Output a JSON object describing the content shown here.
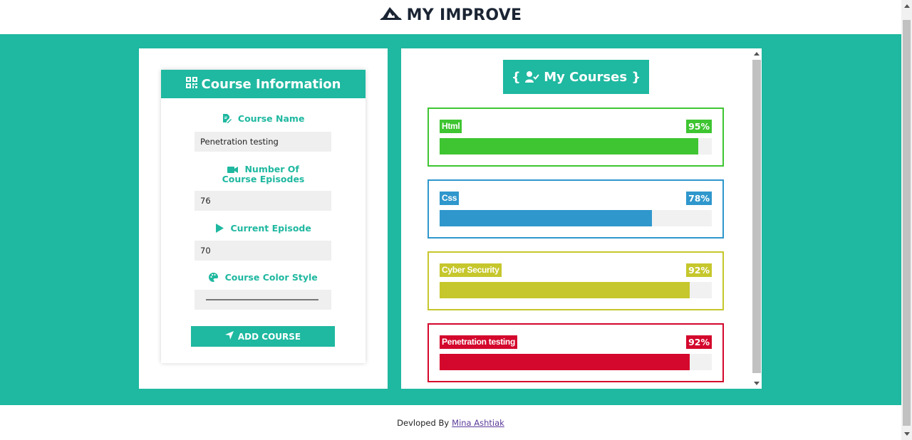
{
  "header": {
    "logo_text": "MY IMPROVE",
    "logo_icon": "paper-plane-logo-icon"
  },
  "form": {
    "title": "Course Information",
    "title_icon": "qrcode-icon",
    "course_name_label": "Course Name",
    "course_name_value": "Penetration testing",
    "episodes_label": "Number Of Course Episodes",
    "episodes_value": "76",
    "current_episode_label": "Current Episode",
    "current_episode_value": "70",
    "color_style_label": "Course Color Style",
    "add_button_label": "ADD COURSE"
  },
  "courses_panel": {
    "title": "{ My Courses }",
    "title_icon": "user-check-icon",
    "courses": [
      {
        "name": "Html",
        "percent_label": "95%",
        "progress": 0.95,
        "color": "#3ec531"
      },
      {
        "name": "Css",
        "percent_label": "78%",
        "progress": 0.78,
        "color": "#2f97cc"
      },
      {
        "name": "Cyber Security",
        "percent_label": "92%",
        "progress": 0.92,
        "color": "#c6c72c"
      },
      {
        "name": "Penetration testing",
        "percent_label": "92%",
        "progress": 0.92,
        "color": "#d4072c"
      }
    ]
  },
  "footer": {
    "prefix": "Devloped By",
    "author": "Mina Ashtiak"
  },
  "colors": {
    "accent": "#1fb8a0"
  }
}
